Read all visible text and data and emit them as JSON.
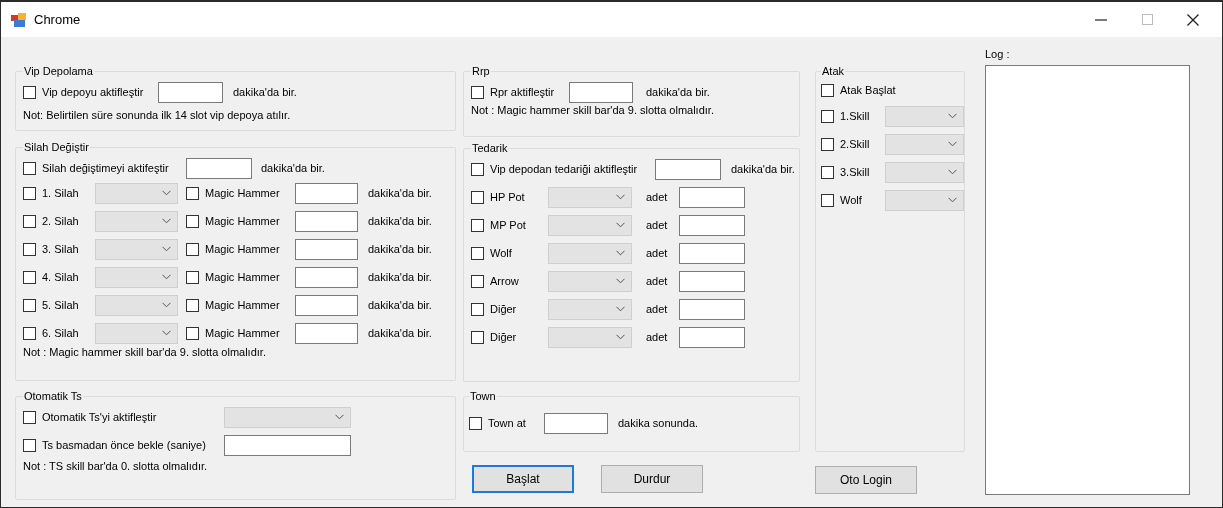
{
  "window": {
    "title": "Chrome"
  },
  "vip_depolama": {
    "title": "Vip Depolama",
    "enable": {
      "label": "Vip depoyu aktifleştir",
      "checked": false
    },
    "suffix": "dakika'da bir.",
    "note": "Not: Belirtilen süre sonunda ilk 14 slot vip depoya atılır."
  },
  "silah_degistir": {
    "title": "Silah Değiştir",
    "enable": {
      "label": "Silah değiştimeyi aktifeştir",
      "checked": false
    },
    "suffix": "dakika'da bir.",
    "weapons": [
      {
        "label": "1. Silah",
        "checked": false,
        "hammer": {
          "label": "Magic Hammer",
          "checked": false
        },
        "suffix": "dakika'da bir."
      },
      {
        "label": "2. Silah",
        "checked": false,
        "hammer": {
          "label": "Magic Hammer",
          "checked": false
        },
        "suffix": "dakika'da bir."
      },
      {
        "label": "3. Silah",
        "checked": false,
        "hammer": {
          "label": "Magic Hammer",
          "checked": false
        },
        "suffix": "dakika'da bir."
      },
      {
        "label": "4. Silah",
        "checked": false,
        "hammer": {
          "label": "Magic Hammer",
          "checked": false
        },
        "suffix": "dakika'da bir."
      },
      {
        "label": "5. Silah",
        "checked": false,
        "hammer": {
          "label": "Magic Hammer",
          "checked": false
        },
        "suffix": "dakika'da bir."
      },
      {
        "label": "6. Silah",
        "checked": false,
        "hammer": {
          "label": "Magic Hammer",
          "checked": false
        },
        "suffix": "dakika'da bir."
      }
    ],
    "note": "Not : Magic hammer skill bar'da 9. slotta olmalıdır."
  },
  "otomatik_ts": {
    "title": "Otomatik Ts",
    "auto": {
      "label": "Otomatik Ts'yi aktifleştir",
      "checked": false
    },
    "wait": {
      "label": "Ts basmadan önce bekle (saniye)",
      "checked": false
    },
    "note": "Not : TS skill bar'da 0. slotta olmalıdır."
  },
  "rrp": {
    "title": "Rrp",
    "enable": {
      "label": "Rpr aktifleştir",
      "checked": false
    },
    "suffix": "dakika'da bir.",
    "note": "Not : Magic hammer skill bar'da 9. slotta olmalıdır."
  },
  "tedarik": {
    "title": "Tedarik",
    "enable": {
      "label": "Vip depodan tedariği aktifleştir",
      "checked": false
    },
    "suffix": "dakika'da bir.",
    "items": [
      {
        "label": "HP Pot",
        "checked": false,
        "unit": "adet"
      },
      {
        "label": "MP Pot",
        "checked": false,
        "unit": "adet"
      },
      {
        "label": "Wolf",
        "checked": false,
        "unit": "adet"
      },
      {
        "label": "Arrow",
        "checked": false,
        "unit": "adet"
      },
      {
        "label": "Diğer",
        "checked": false,
        "unit": "adet"
      },
      {
        "label": "Diğer",
        "checked": false,
        "unit": "adet"
      }
    ]
  },
  "town": {
    "title": "Town",
    "enable": {
      "label": "Town at",
      "checked": false
    },
    "suffix": "dakika sonunda."
  },
  "buttons": [
    {
      "label": "Başlat",
      "focused": true
    },
    {
      "label": "Durdur",
      "focused": false
    }
  ],
  "atak": {
    "title": "Atak",
    "start": {
      "label": "Atak Başlat",
      "checked": false
    },
    "skills": [
      {
        "label": "1.Skill",
        "checked": false
      },
      {
        "label": "2.Skill",
        "checked": false
      },
      {
        "label": "3.Skill",
        "checked": false
      },
      {
        "label": "Wolf",
        "checked": false
      }
    ]
  },
  "oto_login": {
    "label": "Oto Login"
  },
  "log": {
    "label": "Log :"
  }
}
